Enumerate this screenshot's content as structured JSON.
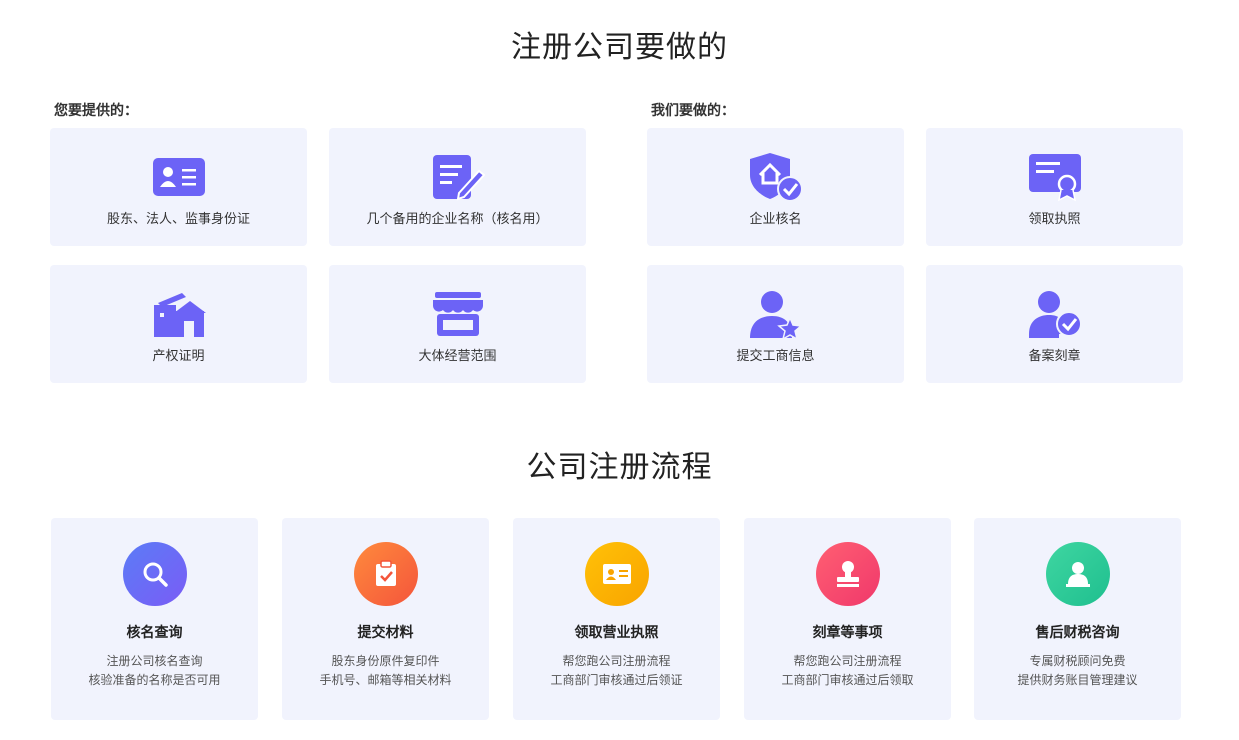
{
  "section1": {
    "title": "注册公司要做的",
    "left_label": "您要提供的：",
    "right_label": "我们要做的：",
    "left_items": [
      {
        "label": "股东、法人、监事身份证",
        "icon": "id-card-icon"
      },
      {
        "label": "几个备用的企业名称（核名用）",
        "icon": "document-edit-icon"
      },
      {
        "label": "产权证明",
        "icon": "property-building-icon"
      },
      {
        "label": "大体经营范围",
        "icon": "storefront-icon"
      }
    ],
    "right_items": [
      {
        "label": "企业核名",
        "icon": "shield-check-icon"
      },
      {
        "label": "领取执照",
        "icon": "license-certificate-icon"
      },
      {
        "label": "提交工商信息",
        "icon": "user-star-icon"
      },
      {
        "label": "备案刻章",
        "icon": "user-check-icon"
      }
    ]
  },
  "section2": {
    "title": "公司注册流程",
    "steps": [
      {
        "title": "核名查询",
        "line1": "注册公司核名查询",
        "line2": "核验准备的名称是否可用",
        "icon": "search-icon",
        "color_from": "#5b7cf7",
        "color_to": "#7a5cf5"
      },
      {
        "title": "提交材料",
        "line1": "股东身份原件复印件",
        "line2": "手机号、邮箱等相关材料",
        "icon": "clipboard-icon",
        "color_from": "#ff8a3d",
        "color_to": "#f4553b"
      },
      {
        "title": "领取营业执照",
        "line1": "帮您跑公司注册流程",
        "line2": "工商部门审核通过后领证",
        "icon": "license-card-icon",
        "color_from": "#ffc107",
        "color_to": "#f9a400"
      },
      {
        "title": "刻章等事项",
        "line1": "帮您跑公司注册流程",
        "line2": "工商部门审核通过后领取",
        "icon": "stamp-icon",
        "color_from": "#ff5f72",
        "color_to": "#f0386b"
      },
      {
        "title": "售后财税咨询",
        "line1": "专属财税顾问免费",
        "line2": "提供财务账目管理建议",
        "icon": "user-consult-icon",
        "color_from": "#3fd6a1",
        "color_to": "#1fbf8f"
      }
    ]
  },
  "colors": {
    "icon_purple": "#6c63f6",
    "card_bg": "#f1f3fd"
  }
}
